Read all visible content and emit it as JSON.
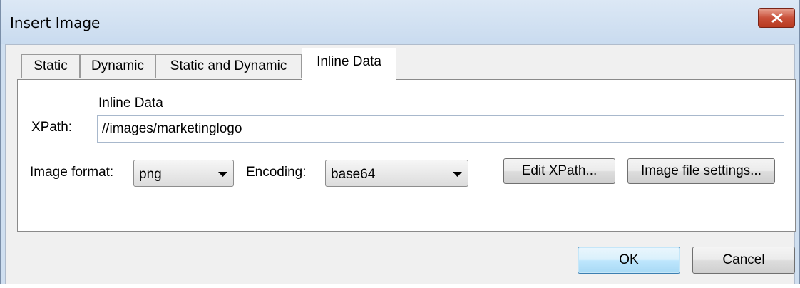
{
  "window": {
    "title": "Insert Image"
  },
  "tabs": [
    {
      "label": "Static"
    },
    {
      "label": "Dynamic"
    },
    {
      "label": "Static and Dynamic"
    },
    {
      "label": "Inline Data"
    }
  ],
  "panel": {
    "group_label": "Inline Data",
    "xpath_label": "XPath:",
    "xpath_value": "//images/marketinglogo",
    "image_format_label": "Image format:",
    "image_format_value": "png",
    "encoding_label": "Encoding:",
    "encoding_value": "base64",
    "edit_xpath_label": "Edit XPath...",
    "image_file_settings_label": "Image file settings..."
  },
  "footer": {
    "ok_label": "OK",
    "cancel_label": "Cancel"
  },
  "icons": {
    "close": "close-icon",
    "dropdown": "chevron-down-icon"
  },
  "colors": {
    "title_bar": "#c9dbef",
    "close_button": "#c9503a",
    "default_button_border": "#3c7fb1"
  }
}
